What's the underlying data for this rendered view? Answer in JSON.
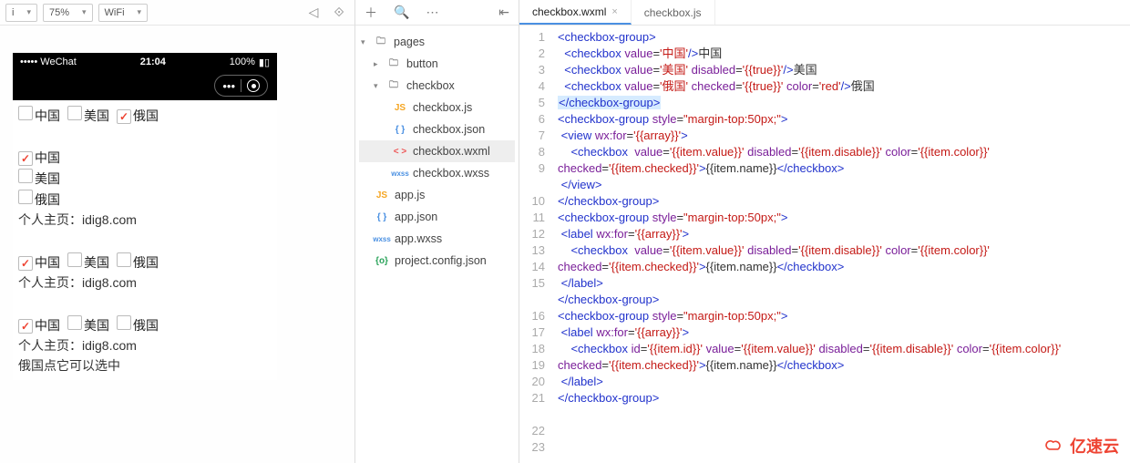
{
  "simulator": {
    "zoom": "75%",
    "network": "WiFi",
    "status": {
      "left": "••••• WeChat",
      "wifi": "⋮",
      "time": "21:04",
      "battery_pct": "100%"
    },
    "page": {
      "row1": [
        {
          "checked": false,
          "label": "中国"
        },
        {
          "checked": false,
          "label": "美国"
        },
        {
          "checked": true,
          "label": "俄国"
        }
      ],
      "sec2": {
        "items": [
          {
            "checked": true,
            "label": "中国"
          },
          {
            "checked": false,
            "label": "美国"
          },
          {
            "checked": false,
            "label": "俄国"
          }
        ],
        "footer": "个人主页：idig8.com"
      },
      "sec3": {
        "items": [
          {
            "checked": true,
            "label": "中国"
          },
          {
            "checked": false,
            "label": "美国"
          },
          {
            "checked": false,
            "label": "俄国"
          }
        ],
        "footer": "个人主页：idig8.com"
      },
      "sec4": {
        "items": [
          {
            "checked": true,
            "label": "中国"
          },
          {
            "checked": false,
            "label": "美国"
          },
          {
            "checked": false,
            "label": "俄国"
          }
        ],
        "footer": "个人主页：idig8.com",
        "note": "俄国点它可以选中"
      }
    }
  },
  "tree": {
    "pages": "pages",
    "button": "button",
    "checkbox": "checkbox",
    "files": {
      "cb_js": "checkbox.js",
      "cb_json": "checkbox.json",
      "cb_wxml": "checkbox.wxml",
      "cb_wxss": "checkbox.wxss",
      "app_js": "app.js",
      "app_json": "app.json",
      "app_wxss": "app.wxss",
      "proj": "project.config.json"
    }
  },
  "tabs": {
    "t1": "checkbox.wxml",
    "t2": "checkbox.js"
  },
  "code": {
    "lines": [
      [
        [
          "tag",
          "<checkbox-group>"
        ]
      ],
      [
        [
          "txt",
          "  "
        ],
        [
          "tag",
          "<checkbox"
        ],
        [
          "txt",
          " "
        ],
        [
          "attr",
          "value"
        ],
        [
          "txt",
          "="
        ],
        [
          "str",
          "'中国'"
        ],
        [
          "tag",
          "/>"
        ],
        [
          "txt",
          "中国"
        ]
      ],
      [
        [
          "txt",
          "  "
        ],
        [
          "tag",
          "<checkbox"
        ],
        [
          "txt",
          " "
        ],
        [
          "attr",
          "value"
        ],
        [
          "txt",
          "="
        ],
        [
          "str",
          "'美国'"
        ],
        [
          "txt",
          " "
        ],
        [
          "attr",
          "disabled"
        ],
        [
          "txt",
          "="
        ],
        [
          "str",
          "'{{true}}'"
        ],
        [
          "tag",
          "/>"
        ],
        [
          "txt",
          "美国"
        ]
      ],
      [
        [
          "txt",
          "  "
        ],
        [
          "tag",
          "<checkbox"
        ],
        [
          "txt",
          " "
        ],
        [
          "attr",
          "value"
        ],
        [
          "txt",
          "="
        ],
        [
          "str",
          "'俄国'"
        ],
        [
          "txt",
          " "
        ],
        [
          "attr",
          "checked"
        ],
        [
          "txt",
          "="
        ],
        [
          "str",
          "'{{true}}'"
        ],
        [
          "txt",
          " "
        ],
        [
          "attr",
          "color"
        ],
        [
          "txt",
          "="
        ],
        [
          "str",
          "'red'"
        ],
        [
          "tag",
          "/>"
        ],
        [
          "txt",
          "俄国"
        ]
      ],
      [
        [
          "hl",
          "</checkbox-group>"
        ]
      ],
      [
        [
          "txt",
          ""
        ]
      ],
      [
        [
          "tag",
          "<checkbox-group"
        ],
        [
          "txt",
          " "
        ],
        [
          "attr",
          "style"
        ],
        [
          "txt",
          "="
        ],
        [
          "str",
          "\"margin-top:50px;\""
        ],
        [
          "tag",
          ">"
        ]
      ],
      [
        [
          "txt",
          " "
        ],
        [
          "tag",
          "<view"
        ],
        [
          "txt",
          " "
        ],
        [
          "attr",
          "wx:for"
        ],
        [
          "txt",
          "="
        ],
        [
          "str",
          "'{{array}}'"
        ],
        [
          "tag",
          ">"
        ]
      ],
      [
        [
          "txt",
          "    "
        ],
        [
          "tag",
          "<checkbox"
        ],
        [
          "txt",
          "  "
        ],
        [
          "attr",
          "value"
        ],
        [
          "txt",
          "="
        ],
        [
          "str",
          "'{{item.value}}'"
        ],
        [
          "txt",
          " "
        ],
        [
          "attr",
          "disabled"
        ],
        [
          "txt",
          "="
        ],
        [
          "str",
          "'{{item.disable}}'"
        ],
        [
          "txt",
          " "
        ],
        [
          "attr",
          "color"
        ],
        [
          "txt",
          "="
        ],
        [
          "str",
          "'{{item.color}}'"
        ],
        [
          "txt",
          " "
        ],
        [
          "attr",
          "checked"
        ],
        [
          "txt",
          "="
        ],
        [
          "str",
          "'{{item.checked}}'"
        ],
        [
          "tag",
          ">"
        ],
        [
          "txt",
          "{{item.name}}"
        ],
        [
          "tag",
          "</checkbox>"
        ]
      ],
      [
        [
          "txt",
          " "
        ],
        [
          "tag",
          "</view>"
        ]
      ],
      [
        [
          "tag",
          "</checkbox-group>"
        ]
      ],
      [
        [
          "txt",
          ""
        ]
      ],
      [
        [
          "tag",
          "<checkbox-group"
        ],
        [
          "txt",
          " "
        ],
        [
          "attr",
          "style"
        ],
        [
          "txt",
          "="
        ],
        [
          "str",
          "\"margin-top:50px;\""
        ],
        [
          "tag",
          ">"
        ]
      ],
      [
        [
          "txt",
          " "
        ],
        [
          "tag",
          "<label"
        ],
        [
          "txt",
          " "
        ],
        [
          "attr",
          "wx:for"
        ],
        [
          "txt",
          "="
        ],
        [
          "str",
          "'{{array}}'"
        ],
        [
          "tag",
          ">"
        ]
      ],
      [
        [
          "txt",
          "    "
        ],
        [
          "tag",
          "<checkbox"
        ],
        [
          "txt",
          "  "
        ],
        [
          "attr",
          "value"
        ],
        [
          "txt",
          "="
        ],
        [
          "str",
          "'{{item.value}}'"
        ],
        [
          "txt",
          " "
        ],
        [
          "attr",
          "disabled"
        ],
        [
          "txt",
          "="
        ],
        [
          "str",
          "'{{item.disable}}'"
        ],
        [
          "txt",
          " "
        ],
        [
          "attr",
          "color"
        ],
        [
          "txt",
          "="
        ],
        [
          "str",
          "'{{item.color}}'"
        ],
        [
          "txt",
          " "
        ],
        [
          "attr",
          "checked"
        ],
        [
          "txt",
          "="
        ],
        [
          "str",
          "'{{item.checked}}'"
        ],
        [
          "tag",
          ">"
        ],
        [
          "txt",
          "{{item.name}}"
        ],
        [
          "tag",
          "</checkbox>"
        ]
      ],
      [
        [
          "txt",
          " "
        ],
        [
          "tag",
          "</label>"
        ]
      ],
      [
        [
          "tag",
          "</checkbox-group>"
        ]
      ],
      [
        [
          "txt",
          ""
        ]
      ],
      [
        [
          "tag",
          "<checkbox-group"
        ],
        [
          "txt",
          " "
        ],
        [
          "attr",
          "style"
        ],
        [
          "txt",
          "="
        ],
        [
          "str",
          "\"margin-top:50px;\""
        ],
        [
          "tag",
          ">"
        ]
      ],
      [
        [
          "txt",
          " "
        ],
        [
          "tag",
          "<label"
        ],
        [
          "txt",
          " "
        ],
        [
          "attr",
          "wx:for"
        ],
        [
          "txt",
          "="
        ],
        [
          "str",
          "'{{array}}'"
        ],
        [
          "tag",
          ">"
        ]
      ],
      [
        [
          "txt",
          "    "
        ],
        [
          "tag",
          "<checkbox"
        ],
        [
          "txt",
          " "
        ],
        [
          "attr",
          "id"
        ],
        [
          "txt",
          "="
        ],
        [
          "str",
          "'{{item.id}}'"
        ],
        [
          "txt",
          " "
        ],
        [
          "attr",
          "value"
        ],
        [
          "txt",
          "="
        ],
        [
          "str",
          "'{{item.value}}'"
        ],
        [
          "txt",
          " "
        ],
        [
          "attr",
          "disabled"
        ],
        [
          "txt",
          "="
        ],
        [
          "str",
          "'{{item.disable}}'"
        ],
        [
          "txt",
          " "
        ],
        [
          "attr",
          "color"
        ],
        [
          "txt",
          "="
        ],
        [
          "str",
          "'{{item.color}}'"
        ],
        [
          "txt",
          " "
        ],
        [
          "attr",
          "checked"
        ],
        [
          "txt",
          "="
        ],
        [
          "str",
          "'{{item.checked}}'"
        ],
        [
          "tag",
          ">"
        ],
        [
          "txt",
          "{{item.name}}"
        ],
        [
          "tag",
          "</checkbox>"
        ]
      ],
      [
        [
          "txt",
          " "
        ],
        [
          "tag",
          "</label>"
        ]
      ],
      [
        [
          "tag",
          "</checkbox-group>"
        ]
      ]
    ]
  },
  "watermark": "亿速云"
}
